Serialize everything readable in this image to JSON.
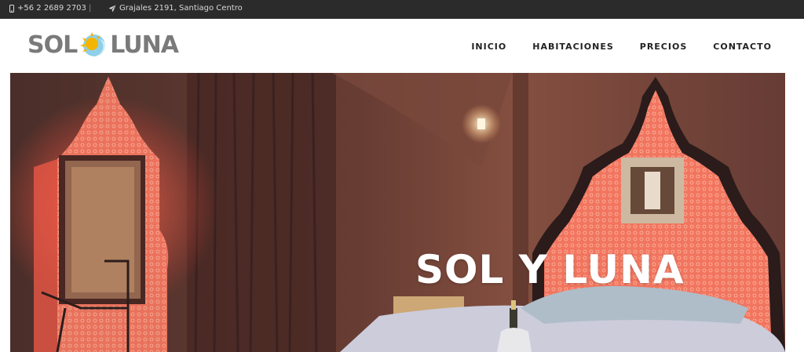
{
  "topbar": {
    "phone_icon": "mobile-phone-icon",
    "phone": "+56 2 2689 2703",
    "separator": "|",
    "address_icon": "paper-plane-icon",
    "address": "Grajales 2191, Santiago Centro",
    "background": "#2b2b2b"
  },
  "header": {
    "logo": {
      "left_word": "SOL",
      "right_word": "LUNA",
      "mark_icon": "sun-moon-icon",
      "sun_color": "#f4b400",
      "moon_color": "#8fd0e8"
    },
    "nav": [
      {
        "label": "INICIO"
      },
      {
        "label": "HABITACIONES"
      },
      {
        "label": "PRECIOS"
      },
      {
        "label": "CONTACTO"
      }
    ]
  },
  "hero": {
    "title": "SOL Y LUNA",
    "image_description_icon": "hotel-room-photo"
  }
}
